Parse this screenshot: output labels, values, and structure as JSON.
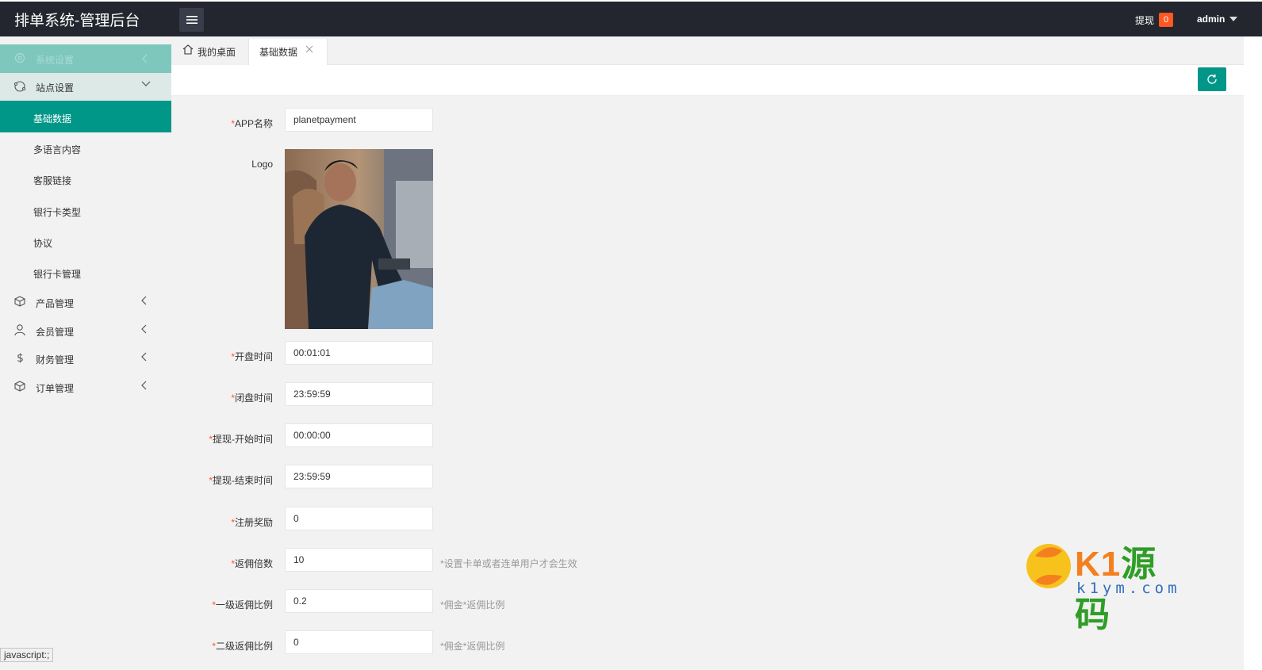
{
  "app": {
    "title": "排单系统-管理后台"
  },
  "header": {
    "withdraw_label": "提现",
    "withdraw_count": "0",
    "user_name": "admin"
  },
  "sidebar": {
    "faded_item": "系统设置",
    "group": {
      "label": "站点设置",
      "items": [
        {
          "label": "基础数据",
          "active": true
        },
        {
          "label": "多语言内容"
        },
        {
          "label": "客服链接"
        },
        {
          "label": "银行卡类型"
        },
        {
          "label": "协议"
        },
        {
          "label": "银行卡管理"
        }
      ]
    },
    "menus": [
      {
        "label": "产品管理",
        "icon": "box-icon"
      },
      {
        "label": "会员管理",
        "icon": "user-icon"
      },
      {
        "label": "财务管理",
        "icon": "dollar-icon"
      },
      {
        "label": "订单管理",
        "icon": "box-icon"
      }
    ]
  },
  "tabs": {
    "home": "我的桌面",
    "active": "基础数据"
  },
  "form": {
    "fields": [
      {
        "label": "APP名称",
        "required": true,
        "value": "planetpayment"
      },
      {
        "label": "Logo",
        "required": false
      },
      {
        "label": "开盘时间",
        "required": true,
        "value": "00:01:01"
      },
      {
        "label": "闭盘时间",
        "required": true,
        "value": "23:59:59"
      },
      {
        "label": "提现-开始时间",
        "required": true,
        "value": "00:00:00"
      },
      {
        "label": "提现-结束时间",
        "required": true,
        "value": "23:59:59"
      },
      {
        "label": "注册奖励",
        "required": true,
        "value": "0"
      },
      {
        "label": "返佣倍数",
        "required": true,
        "value": "10",
        "hint": "*设置卡单或者连单用户才会生效"
      },
      {
        "label": "一级返佣比例",
        "required": true,
        "value": "0.2",
        "hint": "*佣金*返佣比例"
      },
      {
        "label": "二级返佣比例",
        "required": true,
        "value": "0",
        "hint": "*佣金*返佣比例"
      }
    ],
    "required_mark": "*"
  },
  "watermark": {
    "text_latin": "K1",
    "text_cn": "源码",
    "sub": "k1ym.com"
  },
  "statusbar": {
    "text": "javascript:;"
  },
  "colors": {
    "header_bg": "#23262e",
    "accent": "#009688",
    "badge": "#ff5722"
  }
}
